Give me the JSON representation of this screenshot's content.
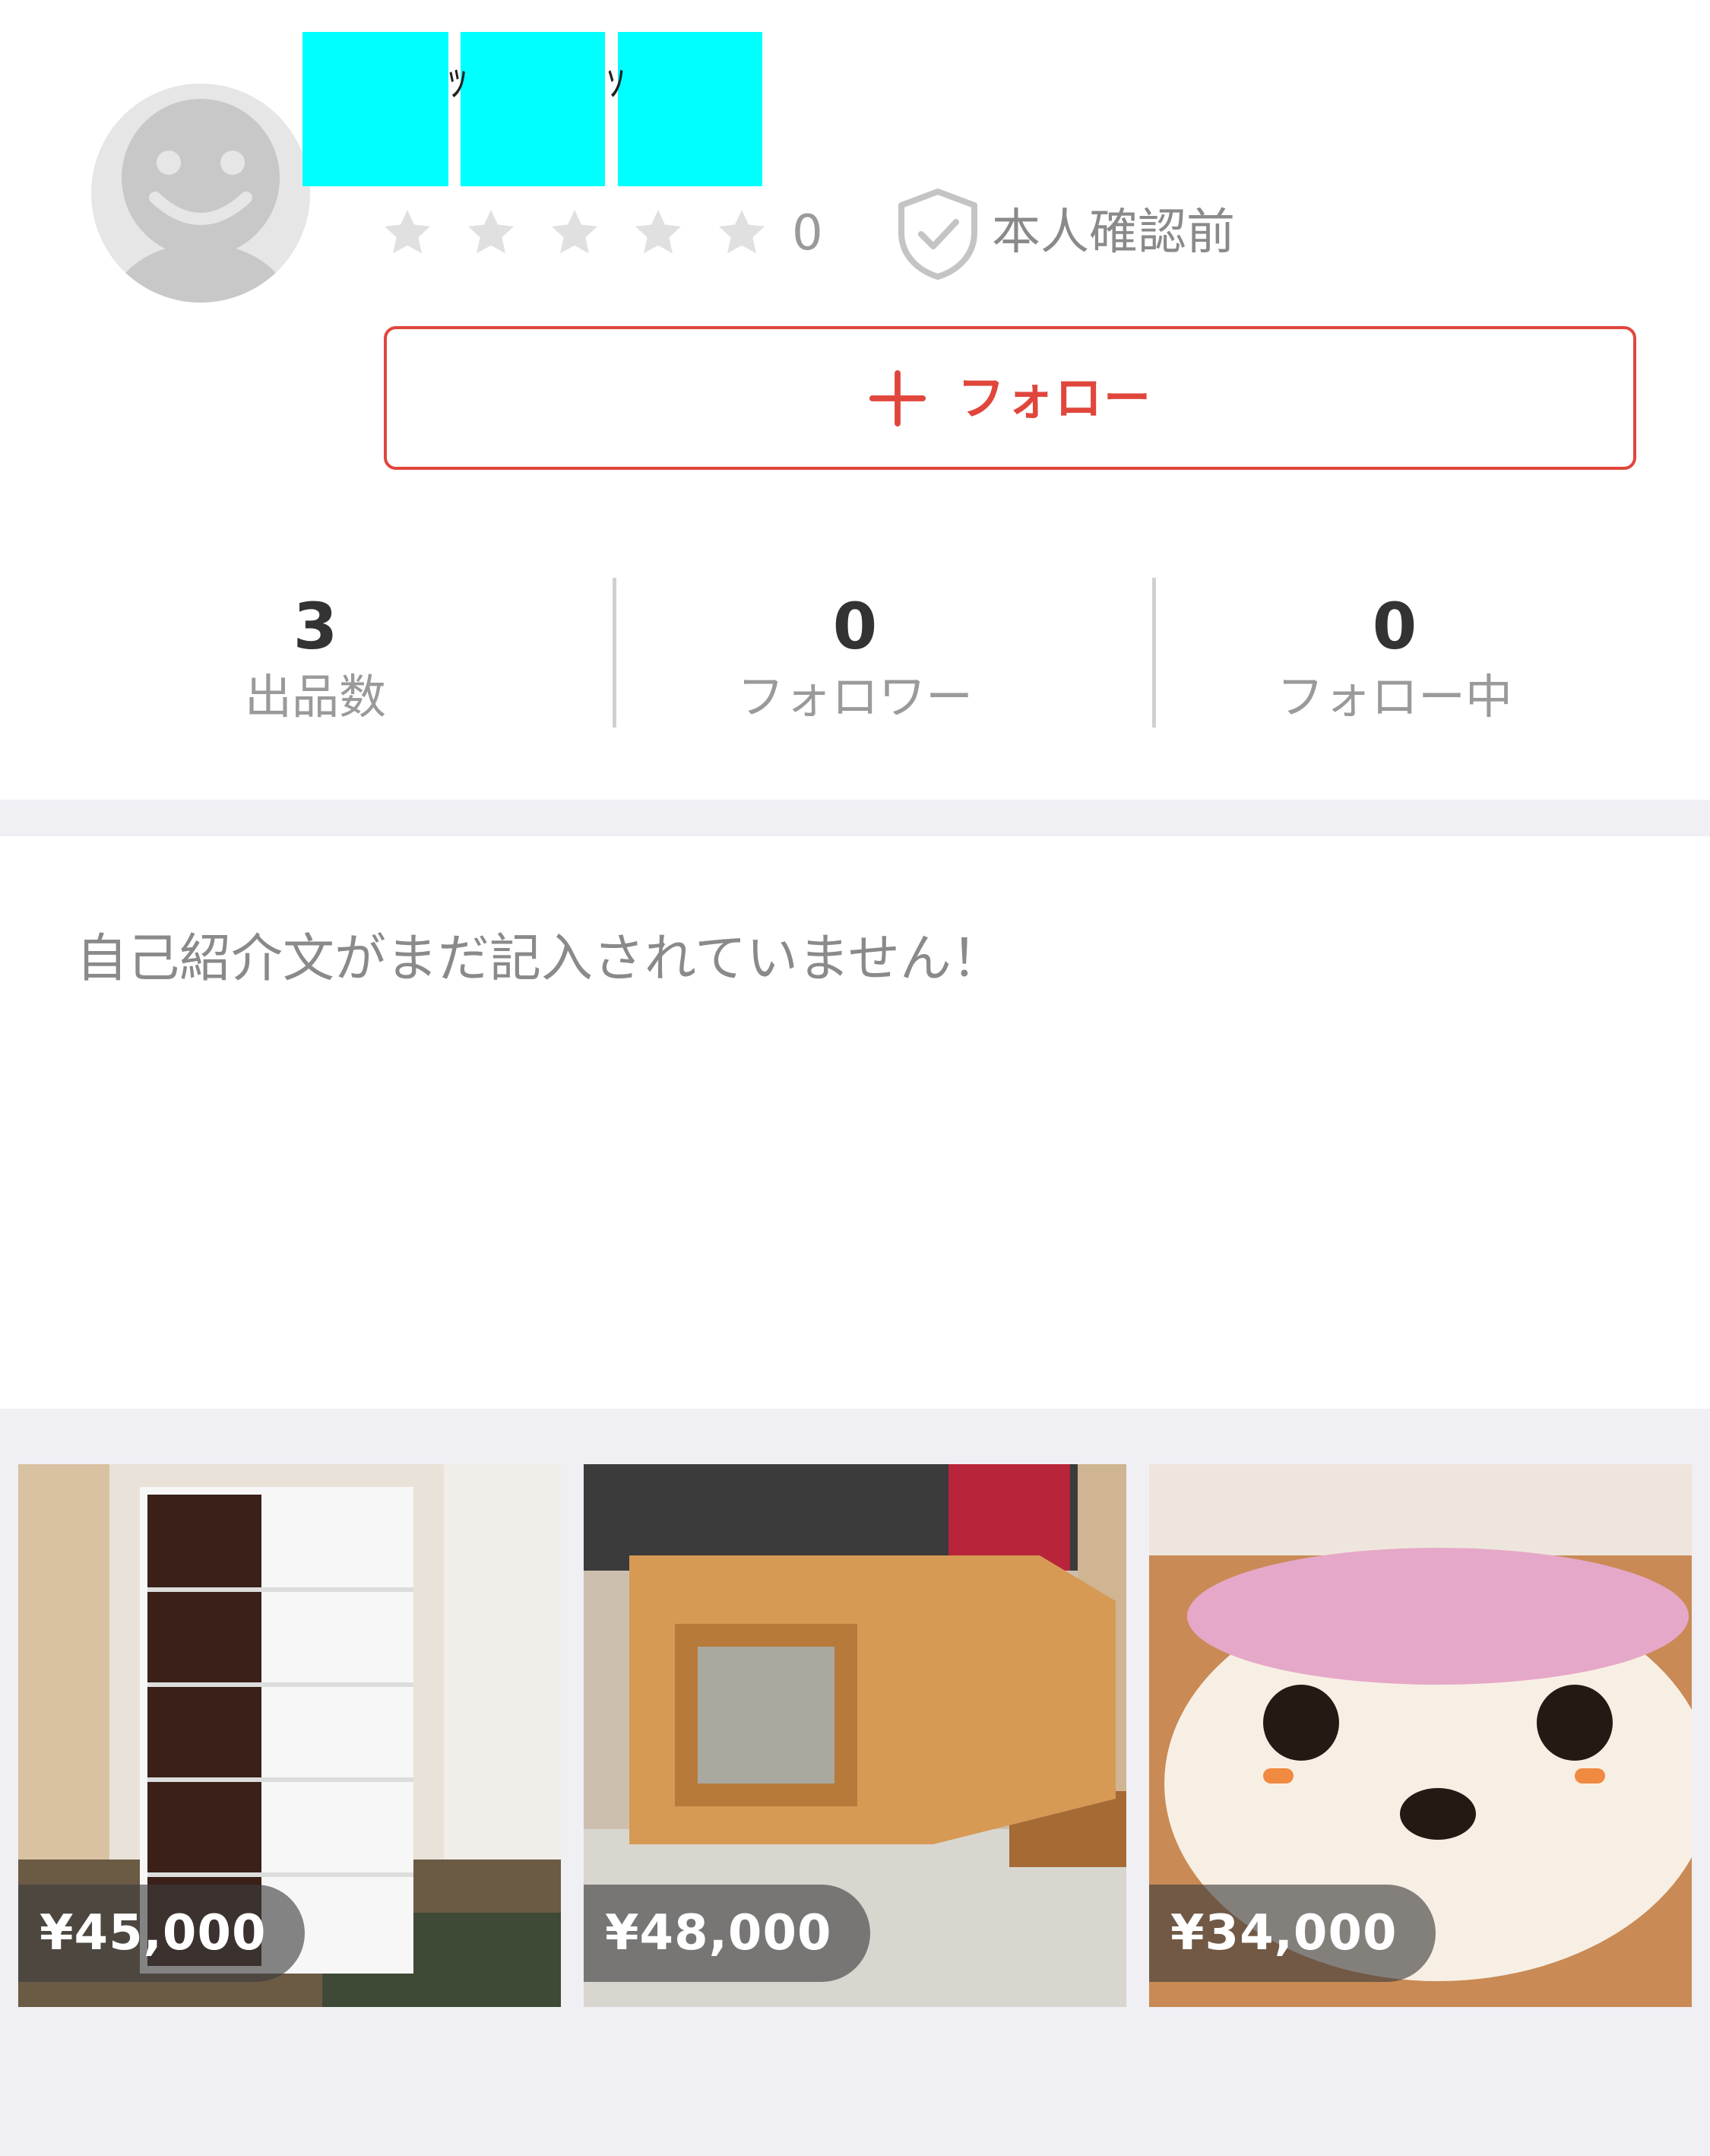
{
  "profile": {
    "name_visible_glyphs": [
      "ﾂ",
      "ｿ"
    ],
    "rating_count": "0",
    "verification_status": "本人確認前"
  },
  "follow_button": {
    "label": "フォロー",
    "icon": "plus-icon"
  },
  "stats": [
    {
      "value": "3",
      "label": "出品数"
    },
    {
      "value": "0",
      "label": "フォロワー"
    },
    {
      "value": "0",
      "label": "フォロー中"
    }
  ],
  "bio": {
    "text": "自己紹介文がまだ記入されていません！"
  },
  "items": [
    {
      "price": "¥45,000",
      "image": "white-and-dark-brown-plastic-drawer-chest"
    },
    {
      "price": "¥48,000",
      "image": "wooden-corner-tv-stand"
    },
    {
      "price": "¥34,000",
      "image": "rilakkuma-bear-bowl-pink-inside"
    }
  ],
  "colors": {
    "accent": "#e0463c",
    "star": "#e0e0e0",
    "muted_text": "#9a9a9a",
    "band_bg": "#efeff4",
    "redaction": "#00ffff"
  }
}
